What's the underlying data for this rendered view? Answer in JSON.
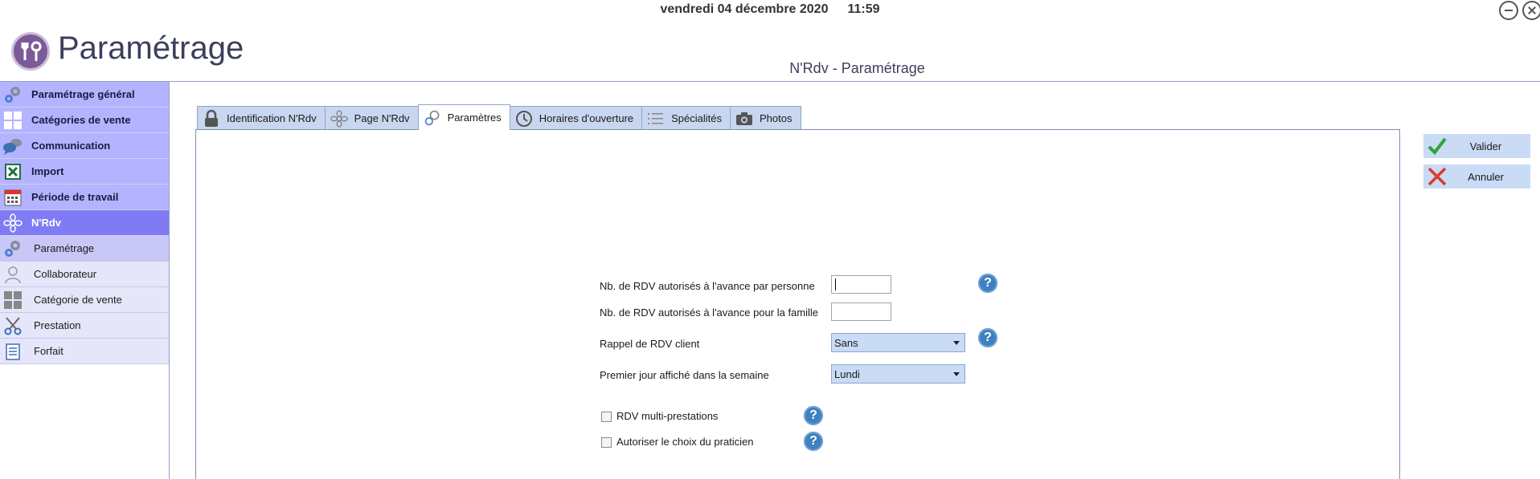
{
  "header": {
    "date": "vendredi 04 décembre 2020",
    "time": "11:59",
    "app_title": "Paramétrage",
    "page_subtitle": "N'Rdv - Paramétrage"
  },
  "sidebar": {
    "items": [
      {
        "label": "Paramétrage général",
        "icon": "gears-icon"
      },
      {
        "label": "Catégories de vente",
        "icon": "grid-icon"
      },
      {
        "label": "Communication",
        "icon": "chat-bubbles-icon"
      },
      {
        "label": "Import",
        "icon": "excel-icon"
      },
      {
        "label": "Période de travail",
        "icon": "calendar-icon"
      },
      {
        "label": "N'Rdv",
        "icon": "flower-icon",
        "active": true
      }
    ],
    "subitems": [
      {
        "label": "Paramétrage",
        "icon": "gears-icon",
        "selected": true
      },
      {
        "label": "Collaborateur",
        "icon": "user-icon"
      },
      {
        "label": "Catégorie de vente",
        "icon": "grid-icon"
      },
      {
        "label": "Prestation",
        "icon": "scissors-icon"
      },
      {
        "label": "Forfait",
        "icon": "list-icon"
      }
    ]
  },
  "tabs": [
    {
      "label": "Identification N'Rdv",
      "icon": "lock-icon"
    },
    {
      "label": "Page N'Rdv",
      "icon": "flower-icon"
    },
    {
      "label": "Paramètres",
      "icon": "gears-icon",
      "active": true
    },
    {
      "label": "Horaires d'ouverture",
      "icon": "clock-icon"
    },
    {
      "label": "Spécialités",
      "icon": "list-icon"
    },
    {
      "label": "Photos",
      "icon": "camera-icon"
    }
  ],
  "form": {
    "rdv_person_label": "Nb. de RDV autorisés à l'avance par personne",
    "rdv_person_value": "",
    "rdv_family_label": "Nb. de RDV autorisés à l'avance pour la famille",
    "rdv_family_value": "",
    "reminder_label": "Rappel de RDV client",
    "reminder_value": "Sans",
    "first_day_label": "Premier jour affiché dans la semaine",
    "first_day_value": "Lundi",
    "multi_label": "RDV multi-prestations",
    "multi_checked": false,
    "practitioner_label": "Autoriser le choix du praticien",
    "practitioner_checked": false,
    "help_glyph": "?"
  },
  "actions": {
    "validate_label": "Valider",
    "cancel_label": "Annuler"
  },
  "colors": {
    "sidebar_item_bg": "#b4b3ff",
    "sidebar_active_bg": "#7f7bf5",
    "tab_bg": "#c9d6ef",
    "help_bg": "#3f80c0",
    "validate_green": "#2fa33a",
    "cancel_red": "#d93a2b"
  }
}
